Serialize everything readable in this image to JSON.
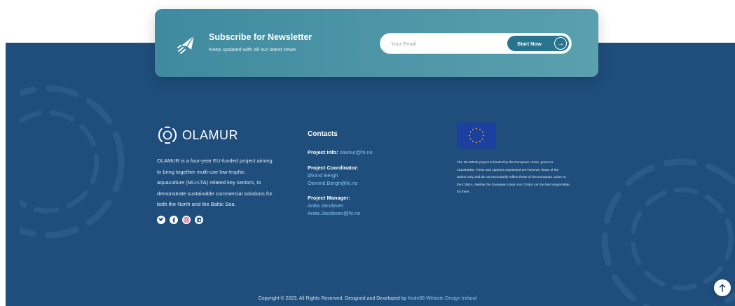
{
  "newsletter": {
    "title": "Subscribe for Newsletter",
    "subtitle": "Keep updated with all our latest news",
    "email_placeholder": "Your Email",
    "button_label": "Start Now",
    "icon": "paper-plane-icon"
  },
  "brand": {
    "name": "OLAMUR",
    "logo_icon": "olamur-logo-icon",
    "about_lines": [
      "OLAMUR is a four-year EU-funded project aiming",
      "to bring together multi-use low-trophic",
      "aquaculture (MU-LTA) related key sectors, to",
      "demonstrate sustainable commercial solutions for",
      "both the North and the Baltic Sea."
    ],
    "socials": [
      "twitter-icon",
      "facebook-icon",
      "instagram-icon",
      "linkedin-icon"
    ]
  },
  "contacts": {
    "heading": "Contacts",
    "project_info_label": "Project Info:",
    "project_info_email": "olamur@hi.no",
    "coordinator_label": "Project Coordinator:",
    "coordinator_name": "Øivind Bergh",
    "coordinator_email": "Oeivind.Bergh@hi.no",
    "manager_label": "Project Manager:",
    "manager_name": "Anita Jacobsen",
    "manager_email": "Anita.Jacobsen@hi.no"
  },
  "eu": {
    "flag_icon": "eu-flag-icon",
    "disclaimer_lines": [
      "The OLAMUR project is funded by the European Union, grant no.",
      "101094065. Views and opinions expressed are however those of the",
      "author only and do not necessarily reflect those of the European Union or",
      "the CINEA. Neither the European Union nor CINEA can be held responsible",
      "for them."
    ]
  },
  "footer": {
    "copyright_text": "Copyright © 2023. All Rights Reserved. Designed and Developed by ",
    "copyright_link": "Kode88 Website Design Ireland"
  },
  "colors": {
    "footer_bg": "#1f4e7c",
    "newsletter_bg": "#4f97a8",
    "button_bg": "#28748f",
    "link": "#8cc6ec"
  }
}
